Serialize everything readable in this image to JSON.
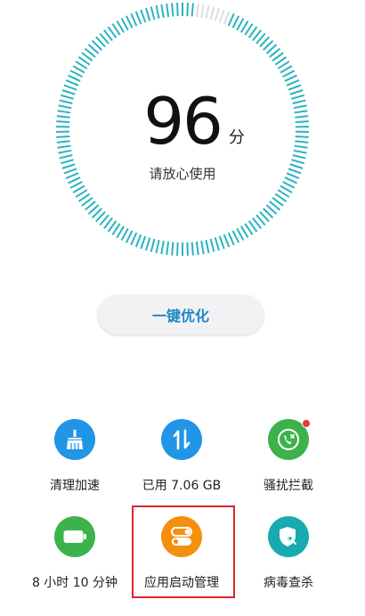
{
  "score": {
    "value": "96",
    "unit": "分",
    "status": "请放心使用"
  },
  "optimize_button": {
    "label": "一键优化"
  },
  "tools": [
    {
      "label": "清理加速",
      "icon": "broom-icon",
      "color": "#2196e6"
    },
    {
      "label": "已用 7.06 GB",
      "icon": "data-transfer-icon",
      "color": "#2196e6"
    },
    {
      "label": "骚扰拦截",
      "icon": "phone-block-icon",
      "color": "#3cb34a"
    },
    {
      "label": "8 小时 10 分钟",
      "icon": "battery-icon",
      "color": "#3cb34a"
    },
    {
      "label": "应用启动管理",
      "icon": "toggle-switch-icon",
      "color": "#f5900f"
    },
    {
      "label": "病毒查杀",
      "icon": "shield-search-icon",
      "color": "#19a9b0"
    }
  ],
  "colors": {
    "accent": "#1e88c8",
    "gauge": "#2bb3c0",
    "highlight": "#e02424"
  }
}
